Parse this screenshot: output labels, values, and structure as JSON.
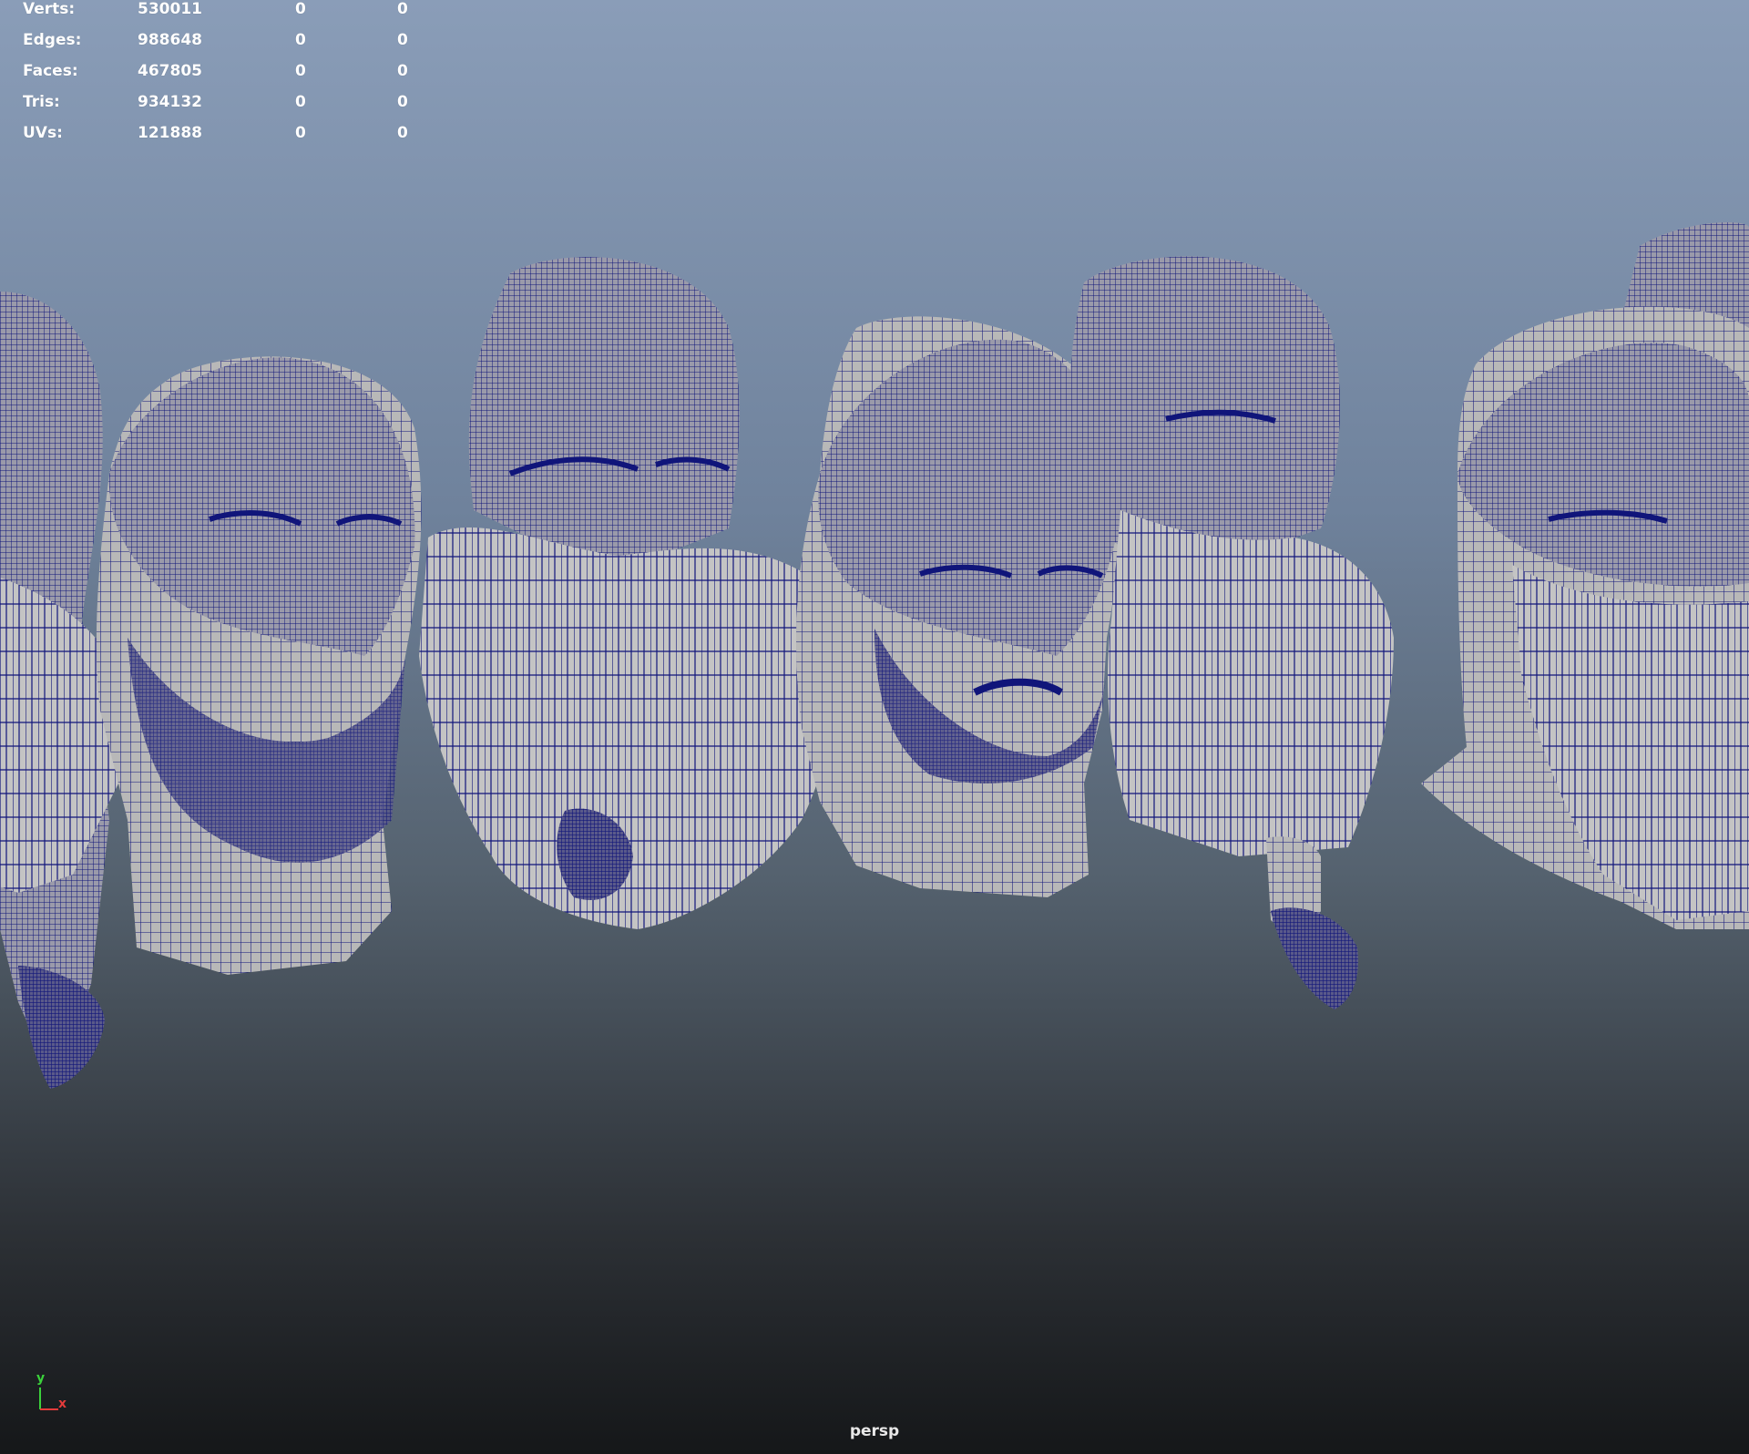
{
  "hud": {
    "rows": [
      {
        "label": "Verts:",
        "value": "530011",
        "col2": "0",
        "col3": "0"
      },
      {
        "label": "Edges:",
        "value": "988648",
        "col2": "0",
        "col3": "0"
      },
      {
        "label": "Faces:",
        "value": "467805",
        "col2": "0",
        "col3": "0"
      },
      {
        "label": "Tris:",
        "value": "934132",
        "col2": "0",
        "col3": "0"
      },
      {
        "label": "UVs:",
        "value": "121888",
        "col2": "0",
        "col3": "0"
      }
    ]
  },
  "viewport": {
    "camera_name": "persp",
    "wire_color": "#10157a",
    "mesh_color": "#bdbdbd",
    "background_top": "#8a9db8",
    "background_bottom": "#151719"
  },
  "axis_indicator": {
    "y_label": "y",
    "x_label": "x",
    "y_color": "#3bd13b",
    "x_color": "#e33b3b"
  }
}
